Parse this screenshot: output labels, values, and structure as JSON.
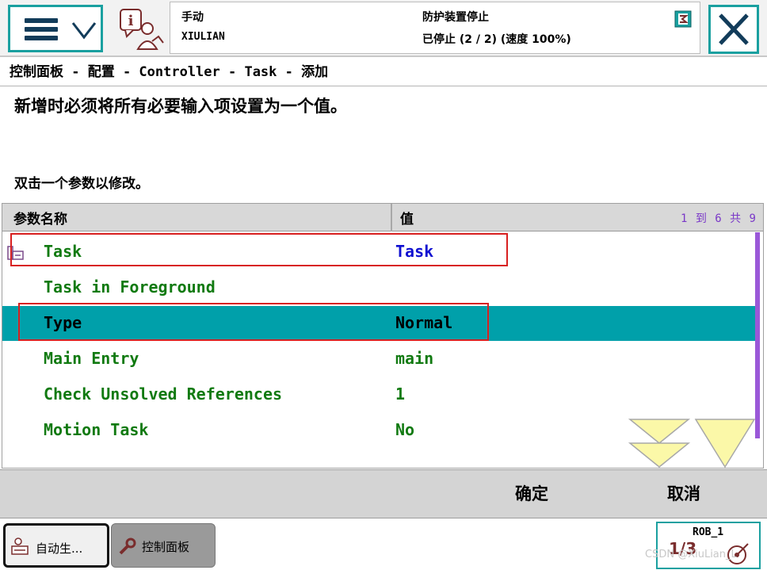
{
  "header": {
    "mode": "手动",
    "controller": "XIULIAN",
    "status": "防护装置停止",
    "run_state": "已停止 (2 / 2) (速度 100%)"
  },
  "breadcrumb": "控制面板 - 配置 - Controller - Task - 添加",
  "instruction": "新增时必须将所有必要输入项设置为一个值。",
  "hint": "双击一个参数以修改。",
  "table": {
    "col_name": "参数名称",
    "col_value": "值",
    "page_indicator": "1 到 6 共 9",
    "rows": [
      {
        "name": "Task",
        "value": "Task",
        "selected": false
      },
      {
        "name": "Task in Foreground",
        "value": "",
        "selected": false
      },
      {
        "name": "Type",
        "value": "Normal",
        "selected": true
      },
      {
        "name": "Main Entry",
        "value": "main",
        "selected": false
      },
      {
        "name": "Check Unsolved References",
        "value": "1",
        "selected": false
      },
      {
        "name": "Motion Task",
        "value": "No",
        "selected": false
      }
    ]
  },
  "footer": {
    "ok_label": "确定",
    "cancel_label": "取消"
  },
  "taskbar": {
    "tasks": [
      {
        "label": "自动生..."
      },
      {
        "label": "控制面板"
      }
    ],
    "rob_label": "ROB_1",
    "rob_fraction": "1/3"
  },
  "watermark": "CSDN @XiuLian_L",
  "colors": {
    "accent": "#1aa0a0",
    "selected_row": "#00a0aa",
    "param_text": "#117a11",
    "value_blue": "#1010d0",
    "highlight": "#d82020",
    "page_indicator": "#7a38c8",
    "scroll_arrow": "#fbf8a8"
  }
}
